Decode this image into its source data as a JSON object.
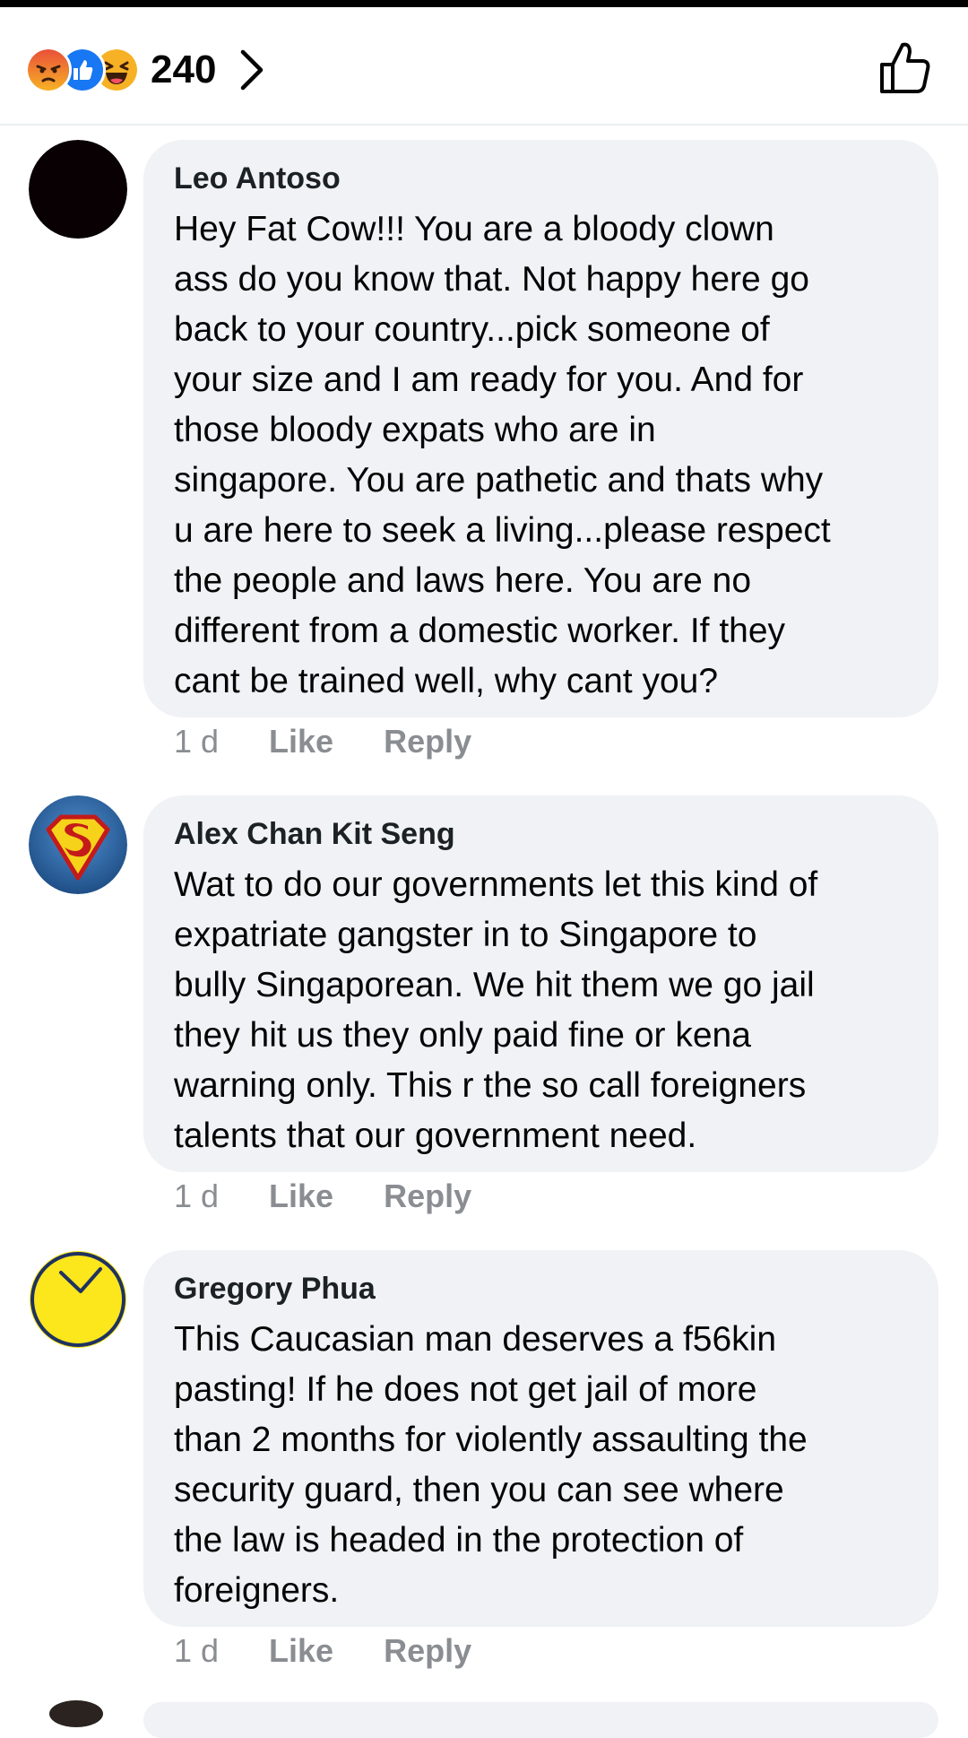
{
  "header": {
    "reaction_icons": [
      "angry-icon",
      "like-icon",
      "haha-icon"
    ],
    "reaction_count": "240"
  },
  "colors": {
    "bubble": "#f0f2f5",
    "meta_gray": "#8a8d91",
    "like_blue": "#1877f2",
    "reaction_yellow": "#f7b125"
  },
  "comments": [
    {
      "author": "Leo Antoso",
      "avatar": "black-circle-avatar",
      "text": "Hey Fat Cow!!! You are a bloody clown\nass do you know that. Not happy here go\nback to your country...pick someone of\nyour size and I am ready for you. And for\nthose bloody expats who are in\nsingapore. You are pathetic and thats why\nu are here to seek a living...please respect\nthe people and laws here. You are no\ndifferent from a domestic worker. If they\ncant be trained well, why cant you?",
      "time": "1 d",
      "like_label": "Like",
      "reply_label": "Reply"
    },
    {
      "author": "Alex Chan Kit Seng",
      "avatar": "superman-logo-avatar",
      "text": "Wat to do our governments let this kind of\nexpatriate gangster in to Singapore to\nbully Singaporean. We hit them we go jail\nthey hit us they only paid fine or kena\nwarning only. This r the so call foreigners\ntalents that our government need.",
      "time": "1 d",
      "like_label": "Like",
      "reply_label": "Reply"
    },
    {
      "author": "Gregory Phua",
      "avatar": "yellow-clock-avatar",
      "text": "This Caucasian man deserves a f56kin\npasting! If he does not get jail of more\nthan 2 months for violently assaulting the\nsecurity guard, then you can see where\nthe law is headed in the protection of\nforeigners.",
      "time": "1 d",
      "like_label": "Like",
      "reply_label": "Reply"
    }
  ]
}
